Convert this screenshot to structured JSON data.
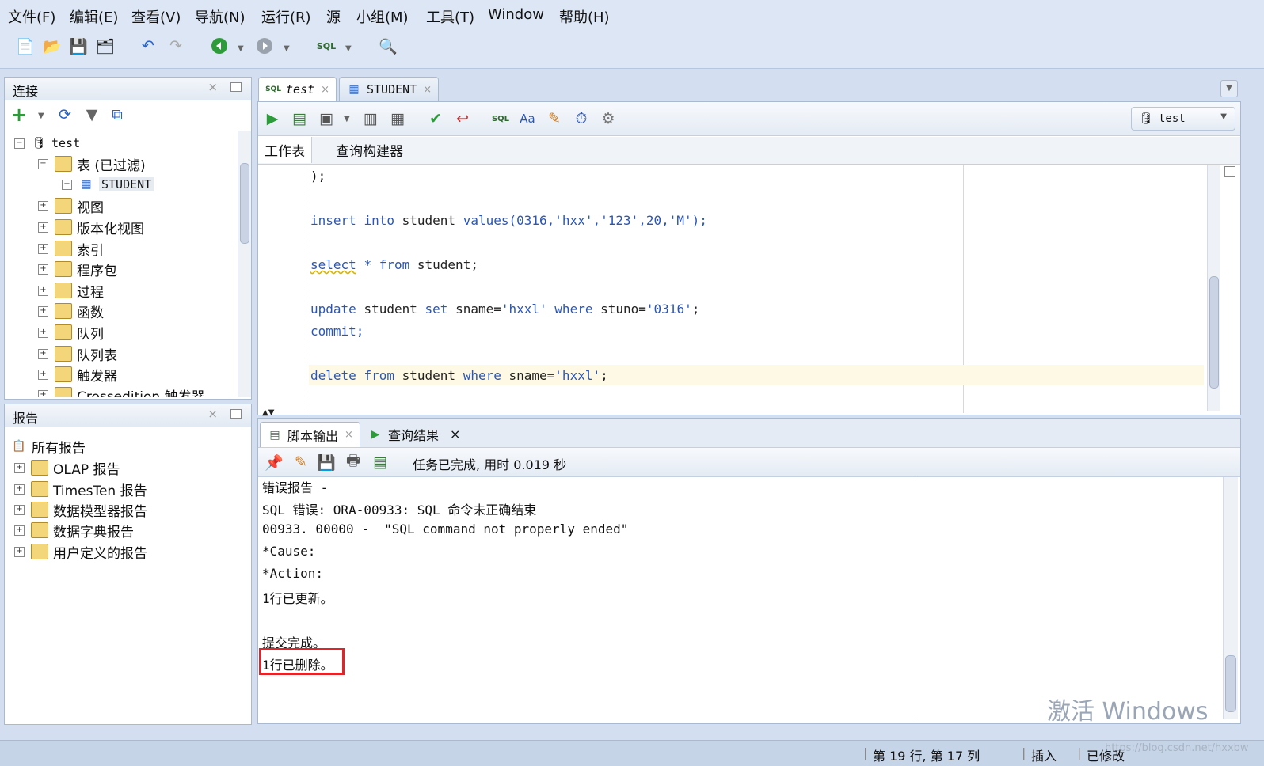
{
  "menu": [
    "文件(F)",
    "编辑(E)",
    "查看(V)",
    "导航(N)",
    "运行(R)",
    "源",
    "小组(M)",
    "工具(T)",
    "Window",
    "帮助(H)"
  ],
  "connections_panel": {
    "title": "连接",
    "root": "test",
    "tables_node": "表 (已过滤)",
    "student_table": "STUDENT",
    "nodes": [
      "视图",
      "版本化视图",
      "索引",
      "程序包",
      "过程",
      "函数",
      "队列",
      "队列表",
      "触发器",
      "Crossedition 触发器"
    ]
  },
  "reports_panel": {
    "title": "报告",
    "root": "所有报告",
    "items": [
      "OLAP 报告",
      "TimesTen 报告",
      "数据模型器报告",
      "数据字典报告",
      "用户定义的报告"
    ]
  },
  "editor_tabs": [
    {
      "label": "test",
      "active": true
    },
    {
      "label": "STUDENT",
      "active": false
    }
  ],
  "connection_select": "test",
  "subtabs": [
    "工作表",
    "查询构建器"
  ],
  "code": {
    "line1": ");",
    "insert": {
      "kw1": "insert",
      "kw2": "into",
      "tbl": "student",
      "kw3": "values",
      "args": "(0316,'hxx','123',20,'M');"
    },
    "select": {
      "kw1": "select",
      "star": "*",
      "kw2": "from",
      "rest": "student;"
    },
    "update": {
      "kw1": "update",
      "tbl": "student",
      "kw2": "set",
      "col": "sname=",
      "v1": "'hxxl'",
      "kw3": "where",
      "col2": "stuno=",
      "v2": "'0316'",
      "end": ";"
    },
    "commit": "commit;",
    "delete": {
      "kw1": "delete",
      "kw2": "from",
      "tbl": "student",
      "kw3": "where",
      "col": "sname=",
      "v": "'hxxl'",
      "end": ";"
    }
  },
  "output_tabs": [
    "脚本输出",
    "查询结果"
  ],
  "output_status": "任务已完成, 用时 0.019 秒",
  "output_lines": [
    "错误报告 -",
    "SQL 错误: ORA-00933: SQL 命令未正确结束",
    "00933. 00000 -  \"SQL command not properly ended\"",
    "*Cause:",
    "*Action:",
    "1行已更新。",
    "",
    "提交完成。",
    "1行已删除。"
  ],
  "status_bar": {
    "position": "第 19 行, 第 17 列",
    "mode": "插入",
    "modified": "已修改",
    "watermark": "激活 Windows",
    "url": "https://blog.csdn.net/hxxbw"
  },
  "colors": {
    "highlight_box": "#e0252a",
    "keyword": "#2a56b8"
  }
}
